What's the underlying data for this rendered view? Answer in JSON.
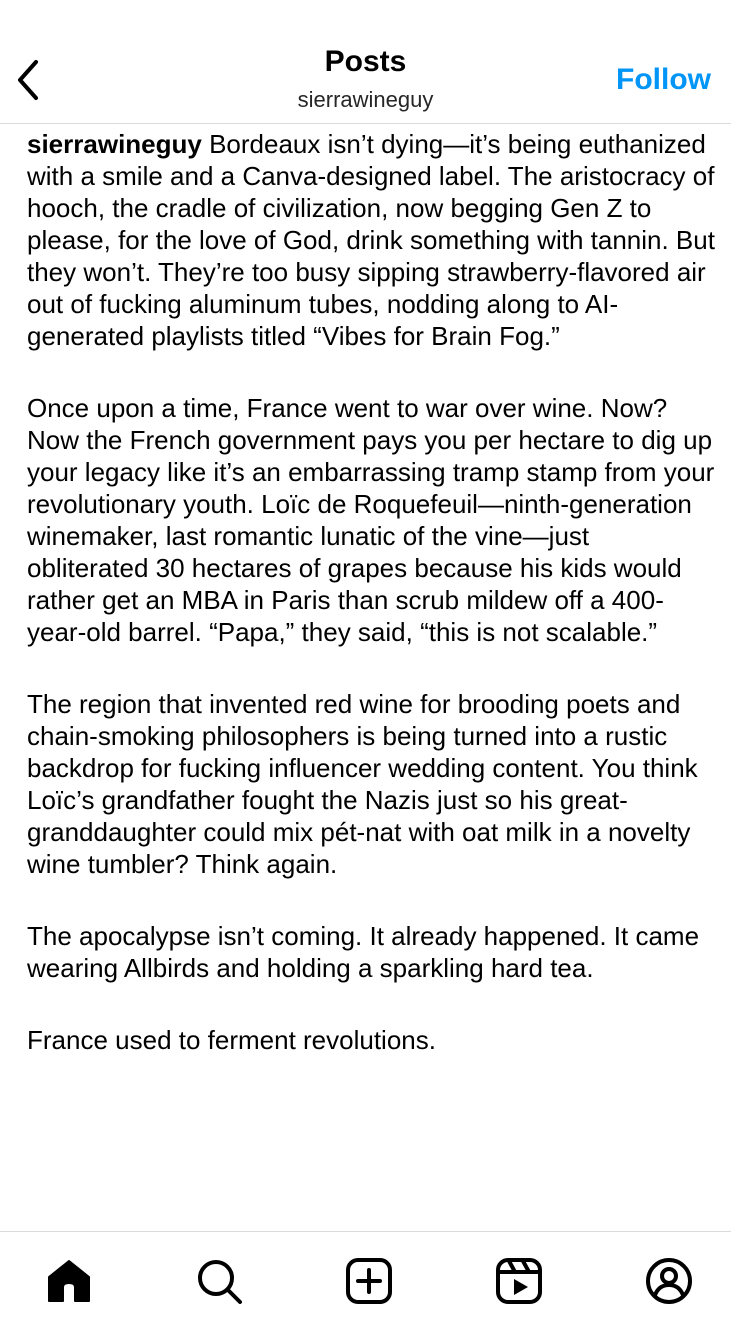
{
  "header": {
    "title": "Posts",
    "subtitle": "sierrawineguy",
    "follow_label": "Follow",
    "back_icon": "chevron-left-icon",
    "accent_color": "#0095f6"
  },
  "post": {
    "username": "sierrawineguy",
    "paragraphs": [
      "Bordeaux isn’t dying—it’s being euthanized with a smile and a Canva-designed label. The aristocracy of hooch, the cradle of civilization, now begging Gen Z to please, for the love of God, drink something with tannin. But they won’t. They’re too busy sipping strawberry-flavored air out of fucking aluminum tubes, nodding along to AI-generated playlists titled “Vibes for Brain Fog.”",
      "Once upon a time, France went to war over wine. Now? Now the French government pays you per hectare to dig up your legacy like it’s an embarrassing tramp stamp from your revolutionary youth. Loïc de Roquefeuil—ninth-generation winemaker, last romantic lunatic of the vine—just obliterated 30 hectares of grapes because his kids would rather get an MBA in Paris than scrub mildew off a 400-year-old barrel. “Papa,” they said, “this is not scalable.”",
      "The region that invented red wine for brooding poets and chain-smoking philosophers is being turned into a rustic backdrop for fucking influencer wedding content. You think Loïc’s grandfather fought the Nazis just so his great-granddaughter could mix pét-nat with oat milk in a novelty wine tumbler? Think again.",
      "The apocalypse isn’t coming. It already happened. It came wearing Allbirds and holding a sparkling hard tea.",
      "France used to ferment revolutions."
    ]
  },
  "bottom_nav": {
    "items": [
      {
        "icon": "home-icon",
        "active": true
      },
      {
        "icon": "search-icon"
      },
      {
        "icon": "create-post-icon"
      },
      {
        "icon": "reels-icon"
      },
      {
        "icon": "profile-icon"
      }
    ]
  }
}
